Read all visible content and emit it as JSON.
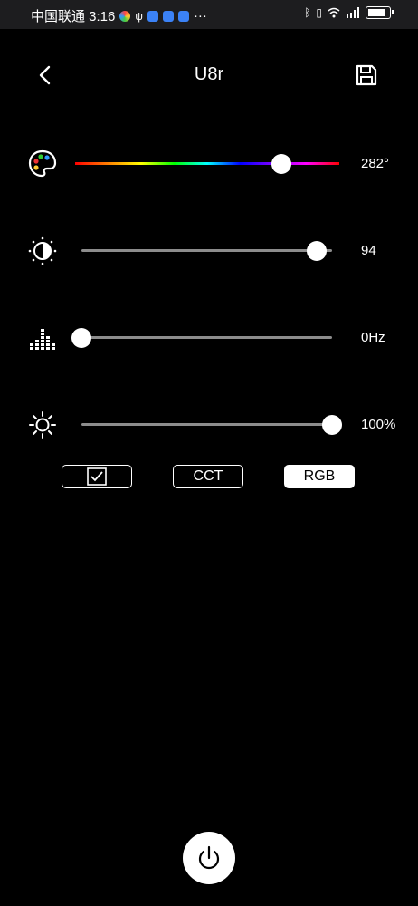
{
  "status_bar": {
    "carrier_time": "中国联通 3:16",
    "more": "···"
  },
  "header": {
    "title": "U8r"
  },
  "sliders": {
    "hue": {
      "value_label": "282°",
      "level": 0.78
    },
    "contrast": {
      "value_label": "94",
      "level": 0.94
    },
    "frequency": {
      "value_label": "0Hz",
      "level": 0.0
    },
    "brightness": {
      "value_label": "100%",
      "level": 1.0
    }
  },
  "modes": {
    "cct_label": "CCT",
    "rgb_label": "RGB",
    "selected": "RGB"
  },
  "colors": {
    "background": "#000000",
    "accent": "#ffffff",
    "track": "#8c8c8c"
  }
}
